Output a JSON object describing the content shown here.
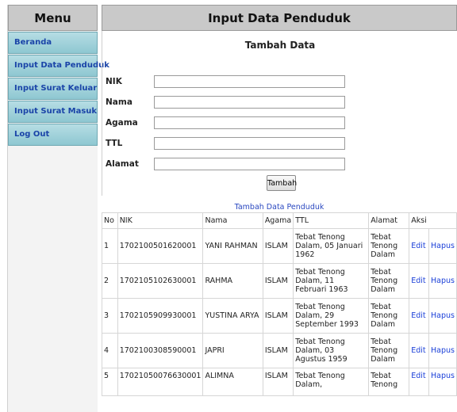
{
  "sidebar": {
    "title": "Menu",
    "items": [
      {
        "label": "Beranda"
      },
      {
        "label": "Input Data Penduduk"
      },
      {
        "label": "Input Surat Keluar"
      },
      {
        "label": "Input Surat Masuk"
      },
      {
        "label": "Log Out"
      }
    ]
  },
  "main": {
    "title": "Input Data Penduduk",
    "form": {
      "title": "Tambah Data",
      "fields": [
        {
          "label": "NIK",
          "value": ""
        },
        {
          "label": "Nama",
          "value": ""
        },
        {
          "label": "Agama",
          "value": ""
        },
        {
          "label": "TTL",
          "value": ""
        },
        {
          "label": "Alamat",
          "value": ""
        }
      ],
      "submit_label": "Tambah"
    },
    "table": {
      "caption": "Tambah Data Penduduk",
      "headers": [
        "No",
        "NIK",
        "Nama",
        "Agama",
        "TTL",
        "Alamat",
        "Aksi"
      ],
      "edit_label": "Edit",
      "delete_label": "Hapus",
      "rows": [
        {
          "no": "1",
          "nik": "1702100501620001",
          "nama": "YANI RAHMAN",
          "agama": "ISLAM",
          "ttl": "Tebat Tenong Dalam, 05 Januari 1962",
          "alamat": "Tebat Tenong Dalam"
        },
        {
          "no": "2",
          "nik": "1702105102630001",
          "nama": "RAHMA",
          "agama": "ISLAM",
          "ttl": "Tebat Tenong Dalam, 11 Februari 1963",
          "alamat": "Tebat Tenong Dalam"
        },
        {
          "no": "3",
          "nik": "1702105909930001",
          "nama": "YUSTINA ARYA",
          "agama": "ISLAM",
          "ttl": "Tebat Tenong Dalam, 29 September 1993",
          "alamat": "Tebat Tenong Dalam"
        },
        {
          "no": "4",
          "nik": "1702100308590001",
          "nama": "JAPRI",
          "agama": "ISLAM",
          "ttl": "Tebat Tenong Dalam, 03 Agustus 1959",
          "alamat": "Tebat Tenong Dalam"
        },
        {
          "no": "5",
          "nik": "17021050076630001",
          "nama": "ALIMNA",
          "agama": "ISLAM",
          "ttl": "Tebat Tenong Dalam,",
          "alamat": "Tebat Tenong"
        }
      ]
    }
  }
}
